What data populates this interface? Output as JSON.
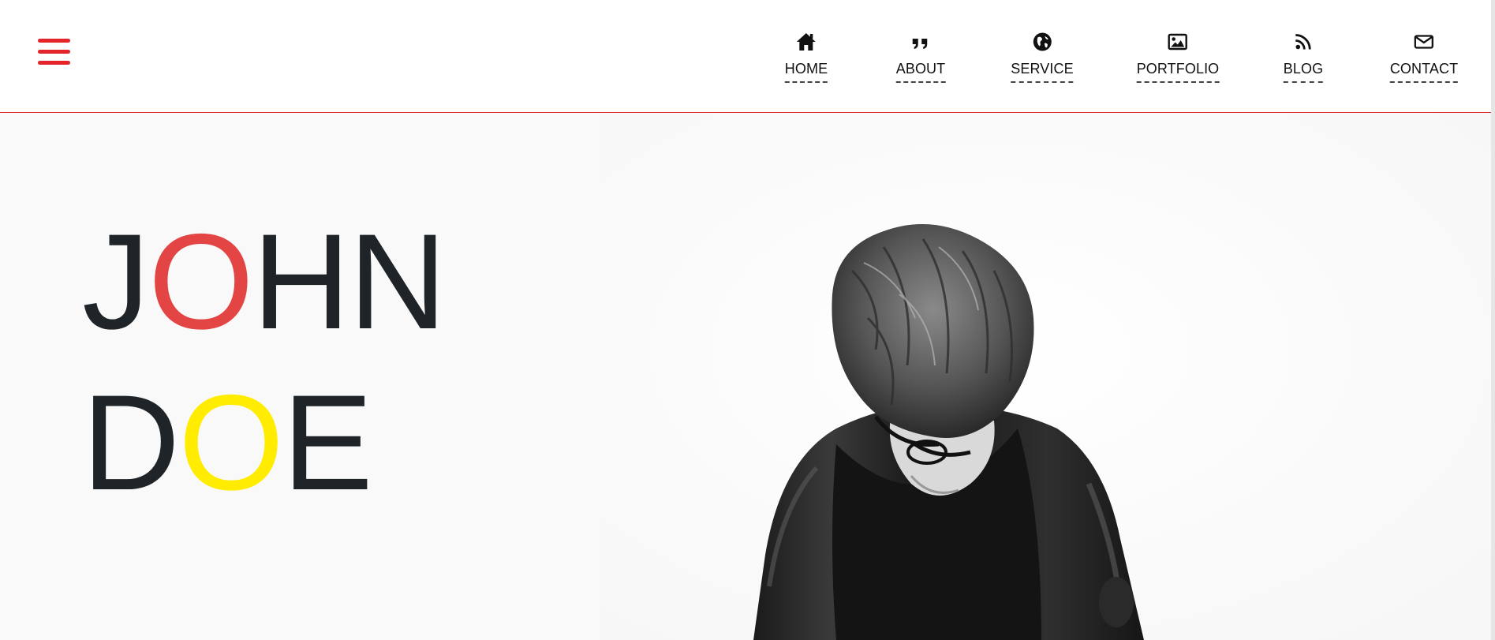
{
  "colors": {
    "accent_red": "#e3242b",
    "name_red": "#e34545",
    "name_yellow": "#ffec00",
    "text_dark": "#1f2428",
    "hero_bg": "#f9f9f9"
  },
  "header": {
    "menu_icon": "hamburger-menu-icon",
    "nav": [
      {
        "label": "HOME",
        "icon": "home-icon"
      },
      {
        "label": "ABOUT",
        "icon": "quote-icon"
      },
      {
        "label": "SERVICE",
        "icon": "globe-icon"
      },
      {
        "label": "PORTFOLIO",
        "icon": "image-icon"
      },
      {
        "label": "BLOG",
        "icon": "rss-icon"
      },
      {
        "label": "CONTACT",
        "icon": "envelope-icon"
      }
    ]
  },
  "hero": {
    "first_name": {
      "pre": "J",
      "accent": "O",
      "post": "HN"
    },
    "last_name": {
      "pre": "D",
      "accent": "O",
      "post": "E"
    },
    "photo": "portrait-photo"
  }
}
